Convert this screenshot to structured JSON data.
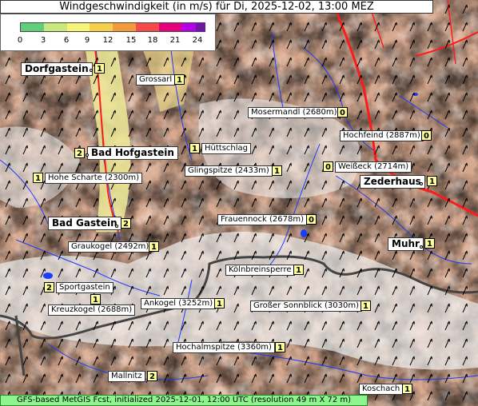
{
  "title": "Windgeschwindigkeit (in m/s) für Di, 2025-12-02, 13:00 MEZ",
  "footer": "GFS-based MetGIS Fcst, initialized 2025-12-01, 12:00 UTC  (resolution 49 m X 72 m)",
  "legend": {
    "ticks": [
      "0",
      "3",
      "6",
      "9",
      "12",
      "15",
      "18",
      "21",
      "24"
    ],
    "colors": [
      "#5fcf7a",
      "#c8e87a",
      "#f5f57a",
      "#f5cf4a",
      "#f59a3a",
      "#f54a4a",
      "#e6007a",
      "#b400e6",
      "#6a1a9a"
    ]
  },
  "places": [
    {
      "id": "dorfgastein",
      "name": "Dorfgastein",
      "value": "1",
      "big": true
    },
    {
      "id": "grossarl",
      "name": "Grossarl",
      "value": "1",
      "big": false
    },
    {
      "id": "mosermandl",
      "name": "Mosermandl (2680m)",
      "value": "0",
      "big": false
    },
    {
      "id": "hochfeind",
      "name": "Hochfeind (2887m)",
      "value": "0",
      "big": false
    },
    {
      "id": "bad-hofgastein",
      "name": "Bad Hofgastein",
      "value": "2",
      "big": true
    },
    {
      "id": "huettschlag",
      "name": "Hüttschlag",
      "value": "1",
      "big": false
    },
    {
      "id": "hohe-scharte",
      "name": "Hohe Scharte (2300m)",
      "value": "1",
      "big": false
    },
    {
      "id": "glingspitze",
      "name": "Glingspitze (2433m)",
      "value": "1",
      "big": false
    },
    {
      "id": "weisseck",
      "name": "Weißeck (2714m)",
      "value": "0",
      "big": false
    },
    {
      "id": "zederhaus",
      "name": "Zederhaus",
      "value": "1",
      "big": true
    },
    {
      "id": "bad-gastein",
      "name": "Bad Gastein",
      "value": "2",
      "big": true
    },
    {
      "id": "frauennock",
      "name": "Frauennock (2678m)",
      "value": "0",
      "big": false
    },
    {
      "id": "graukogel",
      "name": "Graukogel (2492m)",
      "value": "1",
      "big": false
    },
    {
      "id": "muhr",
      "name": "Muhr",
      "value": "1",
      "big": true
    },
    {
      "id": "koelnbreinsperre",
      "name": "Kölnbreinsperre",
      "value": "1",
      "big": false
    },
    {
      "id": "sportgastein",
      "name": "Sportgastein",
      "value": "2",
      "big": false
    },
    {
      "id": "kreuzkogel",
      "name": "Kreuzkogel (2688m)",
      "value": "1",
      "big": false
    },
    {
      "id": "ankogel",
      "name": "Ankogel (3252m)",
      "value": "1",
      "big": false
    },
    {
      "id": "grosser-sonnblick",
      "name": "Großer Sonnblick (3030m)",
      "value": "1",
      "big": false
    },
    {
      "id": "hochalmspitze",
      "name": "Hochalmspitze (3360m)",
      "value": "1",
      "big": false
    },
    {
      "id": "mallnitz",
      "name": "Mallnitz",
      "value": "2",
      "big": false
    },
    {
      "id": "koschach",
      "name": "Koschach",
      "value": "1",
      "big": false
    }
  ]
}
